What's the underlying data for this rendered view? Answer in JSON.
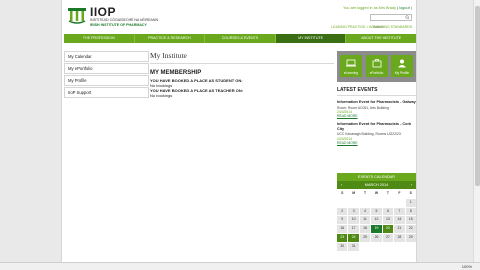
{
  "header": {
    "logo_name": "IIOP",
    "logo_irish": "INSTITIÚID CÓGAISEOIRÍ NA hÉIREANN",
    "logo_english": "IRISH INSTITUTE OF PHARMACY",
    "logged_in_text": "You are logged in as Mrs Brady",
    "logout_label": "( logout )",
    "search_placeholder": "Search",
    "leading_text": "LEADING PRACTICE > ADVANCING STANDARDS"
  },
  "nav": {
    "items": [
      {
        "label": "THE PROFESSION"
      },
      {
        "label": "PRACTICE & RESEARCH"
      },
      {
        "label": "COURSES & EVENTS"
      },
      {
        "label": "MY INSTITUTE"
      },
      {
        "label": "ABOUT THE INSTITUTE"
      }
    ],
    "active_index": 3
  },
  "sidenav": {
    "items": [
      {
        "label": "My Calendar"
      },
      {
        "label": "My ePortfolio"
      },
      {
        "label": "My Profile"
      },
      {
        "label": "IIoP Support"
      }
    ]
  },
  "main": {
    "title": "My Institute",
    "subtitle": "MY MEMBERSHIP",
    "student_label": "YOU HAVE BOOKED A PLACE AS STUDENT ON:",
    "student_value": "No bookings",
    "teacher_label": "YOU HAVE BOOKED A PLACE AS TEACHER ON:",
    "teacher_value": "No bookings"
  },
  "quicklinks": {
    "items": [
      {
        "label": "eLearning",
        "icon": "elearning-icon"
      },
      {
        "label": "ePortfolio",
        "icon": "eportfolio-icon"
      },
      {
        "label": "My Profile",
        "icon": "profile-icon"
      }
    ]
  },
  "events": {
    "heading": "LATEST EVENTS",
    "items": [
      {
        "title": "Information Event for Pharmacists - Galway",
        "location": "Room: Room AC051, Arts Building",
        "date": "24/4/2014",
        "more": "READ MORE"
      },
      {
        "title": "Information Event for Pharmacists - Cork City",
        "location": "UCC Kavanagh Building, Rooms UG22/23",
        "date": "23/4/2014",
        "more": "READ MORE"
      }
    ]
  },
  "calendar": {
    "heading": "EVENTS CALENDAR",
    "month_label": "MARCH 2014",
    "prev": "‹",
    "next": "›",
    "days": [
      "S",
      "M",
      "T",
      "W",
      "T",
      "F",
      "S"
    ],
    "weeks": [
      [
        "",
        "",
        "",
        "",
        "",
        "",
        "1"
      ],
      [
        "2",
        "3",
        "4",
        "5",
        "6",
        "7",
        "8"
      ],
      [
        "9",
        "10",
        "11",
        "12",
        "13",
        "14",
        "15"
      ],
      [
        "16",
        "17",
        "18",
        "19",
        "20",
        "21",
        "22"
      ],
      [
        "23",
        "24",
        "25",
        "26",
        "27",
        "28",
        "29"
      ],
      [
        "30",
        "31",
        "",
        "",
        "",
        "",
        ""
      ]
    ]
  },
  "status": {
    "zoom": "100%"
  },
  "colors": {
    "brand_green": "#6aa91e",
    "dark_green": "#1b7a2a",
    "active_nav": "#3b6e12"
  }
}
